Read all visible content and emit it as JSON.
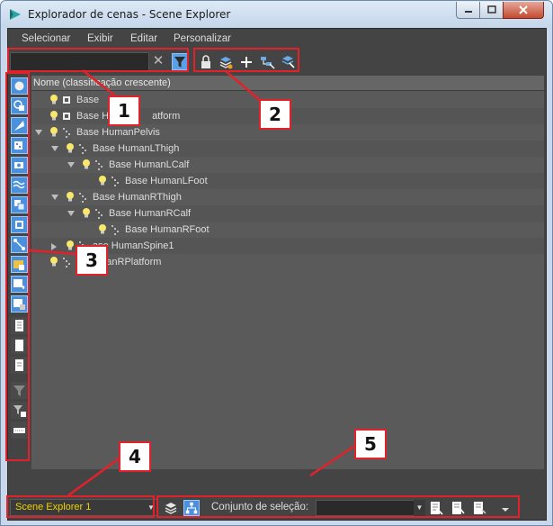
{
  "window": {
    "title": "Explorador de cenas - Scene Explorer"
  },
  "menu": [
    "Selecionar",
    "Exibir",
    "Editar",
    "Personalizar"
  ],
  "search": {
    "value": "",
    "placeholder": ""
  },
  "tree": {
    "column_header": "Nome (classificação crescente)",
    "rows": [
      {
        "label": "Base HumanLPlatform",
        "visible_label": "Base",
        "indent": 0
      },
      {
        "label": "Base HumanRPlatform",
        "visible_label": "Base H",
        "visible_label_end": "atform",
        "indent": 0
      },
      {
        "label": "Base HumanPelvis",
        "indent": 0
      },
      {
        "label": "Base HumanLThigh",
        "indent": 1
      },
      {
        "label": "Base HumanLCalf",
        "indent": 2
      },
      {
        "label": "Base HumanLFoot",
        "indent": 3
      },
      {
        "label": "Base HumanRThigh",
        "indent": 1
      },
      {
        "label": "Base HumanRCalf",
        "indent": 2
      },
      {
        "label": "Base HumanRFoot",
        "indent": 3
      },
      {
        "label": "Base HumanSpine1",
        "visible_label": "ase HumanSpine1",
        "indent": 1
      },
      {
        "label": "Base HumanRPlatform",
        "visible_label": "umanRPlatform",
        "indent": 0
      }
    ]
  },
  "bottom": {
    "explorer_name": "Scene Explorer 1",
    "selection_set_label": "Conjunto de seleção:",
    "selection_set_value": ""
  },
  "annotations": [
    "1",
    "2",
    "3",
    "4",
    "5"
  ],
  "colors": {
    "annotation_red": "#e2222a",
    "explorer_name_yellow": "#f0d000",
    "active_button_blue": "#4a90dc"
  },
  "icons": {
    "sidebar": [
      "display-geometry-icon",
      "display-shapes-icon",
      "display-lights-icon",
      "display-cameras-icon",
      "display-helpers-icon",
      "display-spacewarps-icon",
      "display-groups-icon",
      "display-xrefs-icon",
      "display-bones-icon",
      "display-containers-icon",
      "display-frozen-icon",
      "display-hidden-icon",
      "display-all-icon",
      "display-none-icon",
      "invert-display-icon",
      "filter-icon",
      "filter-settings-icon",
      "more-icon"
    ],
    "toolbar": [
      "lock-icon",
      "layer-icon",
      "add-icon",
      "select-children-icon",
      "select-dependents-icon"
    ],
    "bottom": [
      "layers-mode-icon",
      "hierarchy-mode-icon",
      "create-selection-set-icon",
      "add-to-selection-set-icon",
      "remove-from-selection-set-icon",
      "more-options-icon"
    ]
  }
}
